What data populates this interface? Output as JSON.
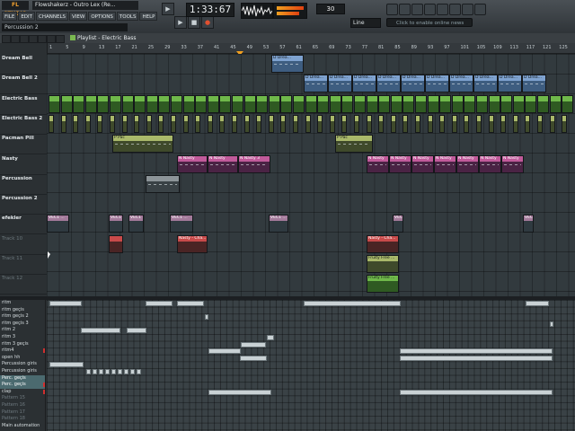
{
  "app": {
    "logo": "FL STUDIO",
    "window_title": "Flowshakerz - Outro Lex (Re..."
  },
  "menu": [
    "FILE",
    "EDIT",
    "CHANNELS",
    "VIEW",
    "OPTIONS",
    "TOOLS",
    "HELP"
  ],
  "hint_bar": "Percussion 2",
  "transport": {
    "time": "1:33:67",
    "pattern_number": "30",
    "snap": "Line",
    "online_label": "Click to enable online news"
  },
  "playlist": {
    "title": "Playlist - Electric Bass"
  },
  "ruler": [
    "1",
    "5",
    "9",
    "13",
    "17",
    "21",
    "25",
    "29",
    "33",
    "37",
    "41",
    "45",
    "49",
    "53",
    "57",
    "61",
    "65",
    "69",
    "73",
    "77",
    "81",
    "85",
    "89",
    "93",
    "97",
    "101",
    "105",
    "109",
    "113",
    "117",
    "121",
    "125"
  ],
  "tracks": [
    {
      "name": "Dream Bell",
      "dim": false
    },
    {
      "name": "Dream Bell 2",
      "dim": false
    },
    {
      "name": "Electric Bass",
      "dim": false
    },
    {
      "name": "Electric Bass 2",
      "dim": false
    },
    {
      "name": "Pacman Pill",
      "dim": false
    },
    {
      "name": "Nasty",
      "dim": false
    },
    {
      "name": "Percussion",
      "dim": false
    },
    {
      "name": "Percussion 2",
      "dim": false
    },
    {
      "name": "efekler",
      "dim": false
    },
    {
      "name": "Track 10",
      "dim": true
    },
    {
      "name": "Track 11",
      "dim": true
    },
    {
      "name": "Track 12",
      "dim": true
    }
  ],
  "clip_labels": {
    "dream": "D Drea...",
    "bass": "",
    "pacman": "P Pac",
    "nasty": "N Nasty",
    "nasty3": "N Nasty 3",
    "vec": "VEC1 ...",
    "auto_nasty": "Nasty - Cha...",
    "fruity": "Fruity Free ...",
    "fruity2": "Fruity Free ..."
  },
  "channels": [
    {
      "name": "ritm",
      "sel": false,
      "dim": false
    },
    {
      "name": "ritm geçis",
      "sel": false,
      "dim": false
    },
    {
      "name": "ritm geçis 2",
      "sel": false,
      "dim": false
    },
    {
      "name": "ritm geçis 3",
      "sel": false,
      "dim": false
    },
    {
      "name": "ritm 2",
      "sel": false,
      "dim": false
    },
    {
      "name": "ritm 3",
      "sel": false,
      "dim": false
    },
    {
      "name": "ritm 3 geçis",
      "sel": false,
      "dim": false
    },
    {
      "name": "ritm4",
      "sel": false,
      "dim": false
    },
    {
      "name": "open hh",
      "sel": false,
      "dim": false
    },
    {
      "name": "Percussion giris",
      "sel": false,
      "dim": false
    },
    {
      "name": "Percussion giris",
      "sel": false,
      "dim": false
    },
    {
      "name": "Perc. geçis",
      "sel": true,
      "dim": false
    },
    {
      "name": "Perc. geçis",
      "sel": true,
      "dim": false
    },
    {
      "name": "clap",
      "sel": false,
      "dim": false
    },
    {
      "name": "Pattern 15",
      "sel": false,
      "dim": true
    },
    {
      "name": "Pattern 16",
      "sel": false,
      "dim": true
    },
    {
      "name": "Pattern 17",
      "sel": false,
      "dim": true
    },
    {
      "name": "Pattern 18",
      "sel": false,
      "dim": true
    },
    {
      "name": "Main automation",
      "sel": false,
      "dim": false
    }
  ]
}
